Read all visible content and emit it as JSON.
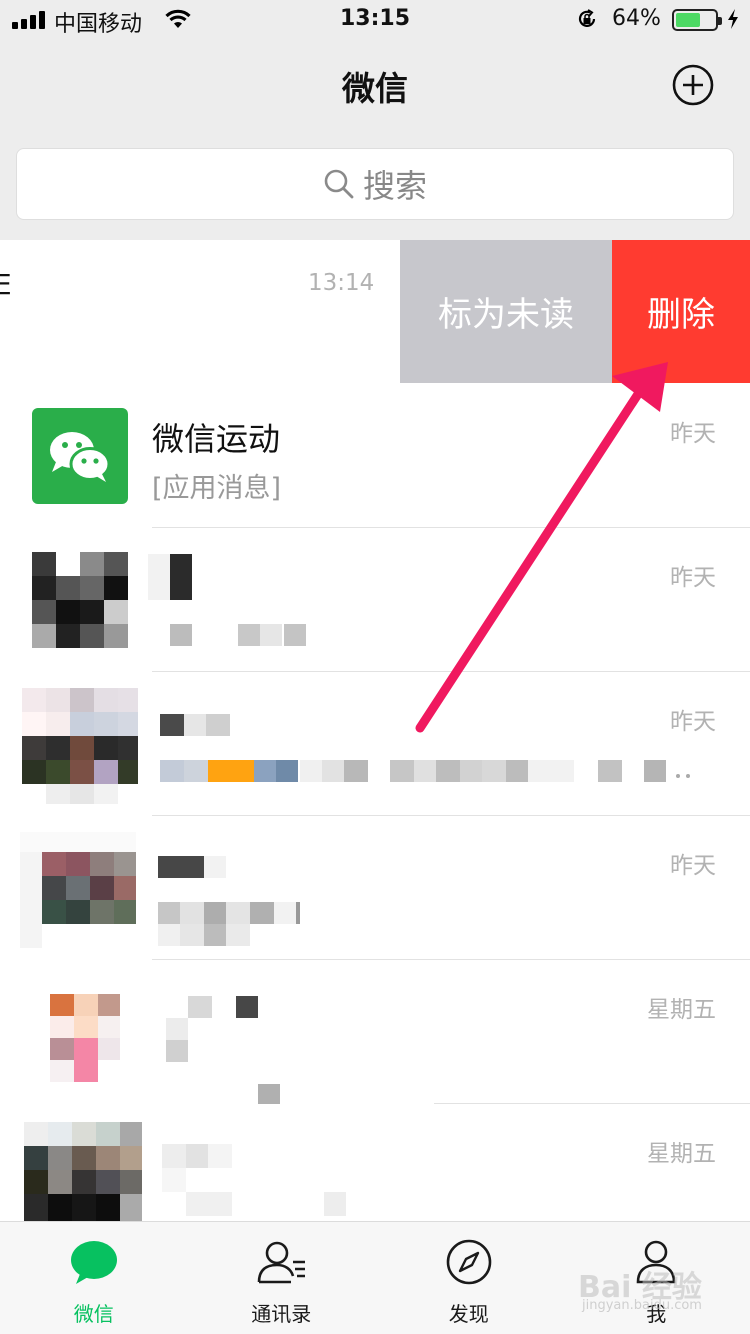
{
  "status_bar": {
    "carrier": "中国移动",
    "time": "13:15",
    "battery_percent": "64%",
    "battery_level": 0.64,
    "battery_color": "#4cd964"
  },
  "nav": {
    "title": "微信",
    "add_icon": "plus-circle-icon"
  },
  "search": {
    "placeholder": "搜索",
    "icon": "search-icon"
  },
  "swiped_row": {
    "time": "13:14",
    "edge_text": "E",
    "mark_unread_label": "标为未读",
    "delete_label": "删除",
    "mark_unread_color": "#c7c7cc",
    "delete_color": "#ff3b30"
  },
  "chats": [
    {
      "name": "微信运动",
      "preview": "[应用消息]",
      "time": "昨天"
    },
    {
      "name": "",
      "preview": "",
      "time": "昨天"
    },
    {
      "name": "",
      "preview": "",
      "time": "昨天"
    },
    {
      "name": "",
      "preview": "",
      "time": "昨天"
    },
    {
      "name": "",
      "preview": "",
      "time": "星期五"
    },
    {
      "name": "",
      "preview": "",
      "time": "星期五"
    }
  ],
  "tab_bar": {
    "accent_color": "#07c160",
    "tabs": [
      {
        "label": "微信",
        "icon": "chat-bubble-icon",
        "active": true
      },
      {
        "label": "通讯录",
        "icon": "contacts-icon",
        "active": false
      },
      {
        "label": "发现",
        "icon": "compass-icon",
        "active": false
      },
      {
        "label": "我",
        "icon": "person-icon",
        "active": false
      }
    ]
  },
  "watermark": {
    "text": "Bai 经验",
    "sub": "jingyan.baidu.com"
  },
  "annotation_arrow_color": "#f0195f"
}
